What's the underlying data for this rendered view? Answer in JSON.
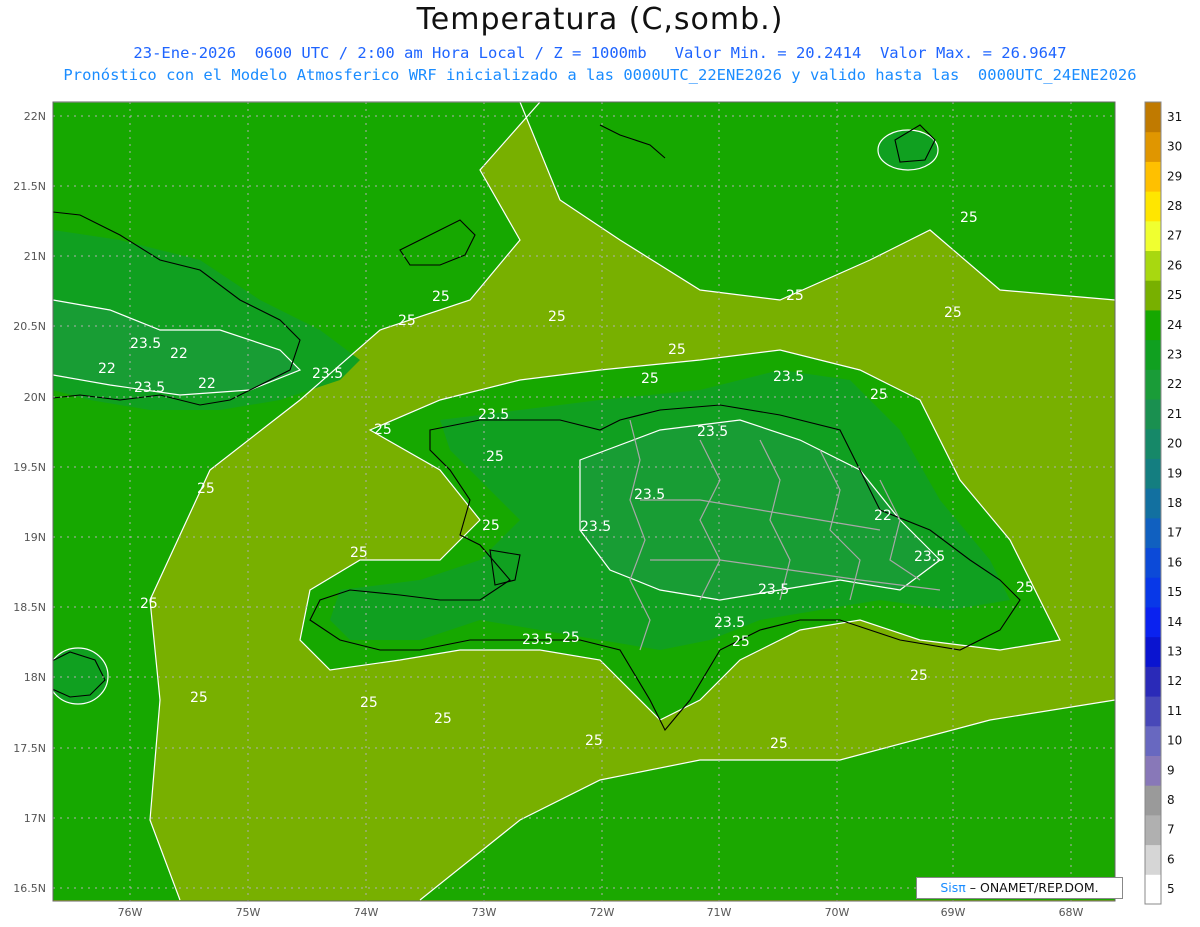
{
  "header": {
    "title": "Temperatura (C,somb.)",
    "line1": "23-Ene-2026  0600 UTC / 2:00 am Hora Local / Z = 1000mb   Valor Min. = 20.2414  Valor Max. = 26.9647",
    "line2": "Pronóstico con el Modelo Atmosferico WRF inicializado a las 0000UTC_22ENE2026 y valido hasta las  0000UTC_24ENE2026"
  },
  "axes": {
    "lat_labels": [
      "22N",
      "21.5N",
      "21N",
      "20.5N",
      "20N",
      "19.5N",
      "19N",
      "18.5N",
      "18N",
      "17.5N",
      "17N",
      "16.5N"
    ],
    "lon_labels": [
      "76W",
      "75W",
      "74W",
      "73W",
      "72W",
      "71W",
      "70W",
      "69W",
      "68W"
    ]
  },
  "colorbar": {
    "labels": [
      "31",
      "30",
      "29",
      "28",
      "27",
      "26",
      "25",
      "24",
      "23",
      "22",
      "21",
      "20",
      "19",
      "18",
      "17",
      "16",
      "15",
      "14",
      "13",
      "12",
      "11",
      "10",
      "9",
      "8",
      "7",
      "6",
      "5"
    ],
    "colors": [
      "#c07a00",
      "#e09600",
      "#ffc000",
      "#ffe600",
      "#f0ff30",
      "#a8d810",
      "#78b000",
      "#16a800",
      "#10a020",
      "#1a9c38",
      "#1a9050",
      "#168868",
      "#147e80",
      "#1270a0",
      "#1060c0",
      "#0c4ad8",
      "#0838e8",
      "#0a22f0",
      "#0a14d0",
      "#2a2ab8",
      "#4848b8",
      "#6868c0",
      "#8878b8",
      "#9a9a9a",
      "#b0b0b0",
      "#d6d6d6",
      "#ffffff"
    ]
  },
  "contour_labels": [
    {
      "text": "25"
    },
    {
      "text": "25"
    },
    {
      "text": "25"
    },
    {
      "text": "25"
    },
    {
      "text": "25"
    },
    {
      "text": "25"
    },
    {
      "text": "25"
    },
    {
      "text": "25"
    },
    {
      "text": "25"
    },
    {
      "text": "25"
    },
    {
      "text": "25"
    },
    {
      "text": "25"
    },
    {
      "text": "25"
    },
    {
      "text": "25"
    },
    {
      "text": "25"
    },
    {
      "text": "25"
    },
    {
      "text": "25"
    },
    {
      "text": "25"
    },
    {
      "text": "25"
    },
    {
      "text": "25"
    },
    {
      "text": "25"
    },
    {
      "text": "25"
    },
    {
      "text": "25"
    },
    {
      "text": "25"
    },
    {
      "text": "23.5"
    },
    {
      "text": "23.5"
    },
    {
      "text": "23.5"
    },
    {
      "text": "23.5"
    },
    {
      "text": "23.5"
    },
    {
      "text": "23.5"
    },
    {
      "text": "23.5"
    },
    {
      "text": "23.5"
    },
    {
      "text": "23.5"
    },
    {
      "text": "23.5"
    },
    {
      "text": "23.5"
    },
    {
      "text": "23.5"
    },
    {
      "text": "22"
    },
    {
      "text": "22"
    },
    {
      "text": "22"
    },
    {
      "text": "22"
    }
  ],
  "credit": {
    "brand": "Sisπ",
    "text": " – ONAMET/REP.DOM."
  }
}
